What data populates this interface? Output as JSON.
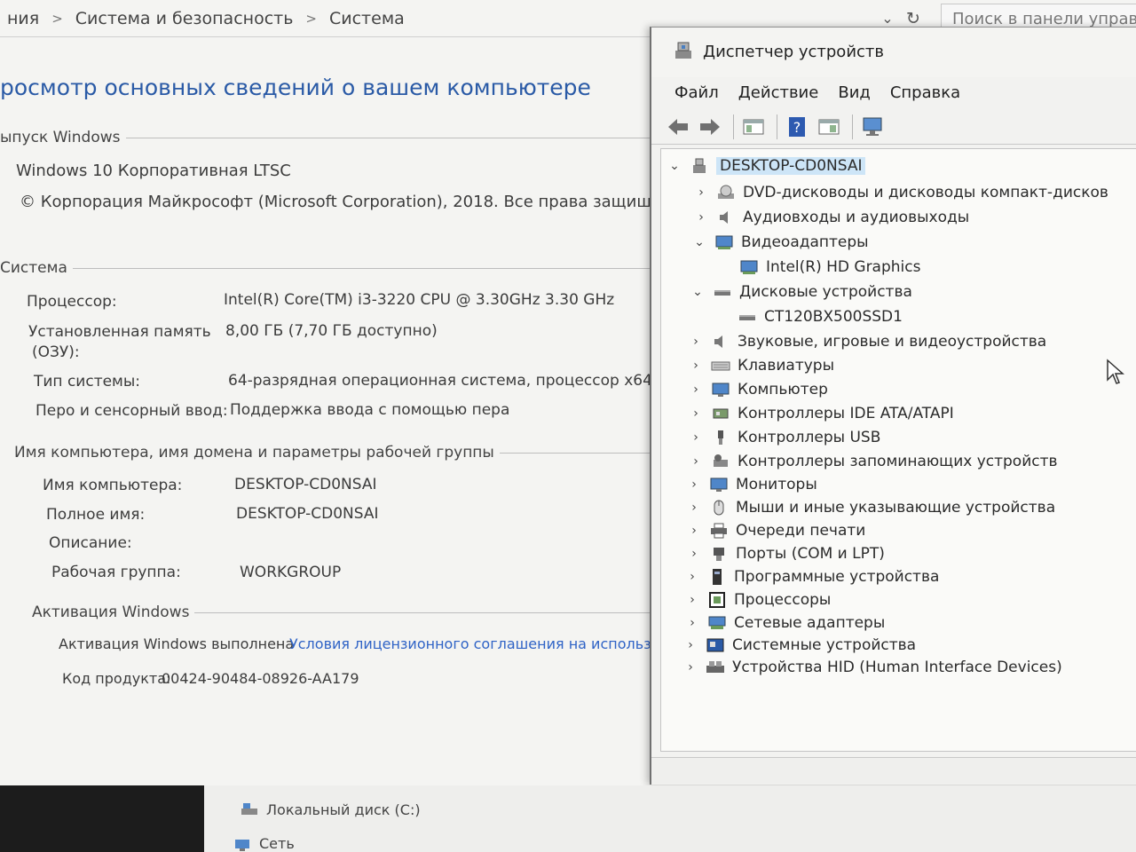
{
  "address_bar": {
    "crumbs": [
      "ния",
      "Система и безопасность",
      "Система"
    ],
    "search_placeholder": "Поиск в панели управл"
  },
  "system": {
    "title": "росмотр основных сведений о вашем компьютере",
    "windows_edition_header": "ыпуск Windows",
    "edition": "Windows 10 Корпоративная LTSC",
    "copyright": "© Корпорация Майкрософт (Microsoft Corporation), 2018. Все права защищены.",
    "system_header": "Система",
    "processor_label": "Процессор:",
    "processor_value": "Intel(R) Core(TM) i3-3220 CPU @ 3.30GHz   3.30 GHz",
    "memory_label_1": "Установленная память",
    "memory_label_2": "(ОЗУ):",
    "memory_value": "8,00 ГБ (7,70 ГБ доступно)",
    "systype_label": "Тип системы:",
    "systype_value": "64-разрядная операционная система, процессор x64",
    "pen_label": "Перо и сенсорный ввод:",
    "pen_value": "Поддержка ввода с помощью пера",
    "computer_header": "Имя компьютера, имя домена и параметры рабочей группы",
    "computer_name_label": "Имя компьютера:",
    "computer_name_value": "DESKTOP-CD0NSAI",
    "full_name_label": "Полное имя:",
    "full_name_value": "DESKTOP-CD0NSAI",
    "description_label": "Описание:",
    "workgroup_label": "Рабочая группа:",
    "workgroup_value": "WORKGROUP",
    "activation_header": "Активация Windows",
    "activation_status": "Активация Windows выполнена",
    "activation_link": "Условия лицензионного соглашения на использов",
    "product_key_label": "Код продукта:",
    "product_key_value": "00424-90484-08926-AA179"
  },
  "device_manager": {
    "title": "Диспетчер устройств",
    "menu": [
      "Файл",
      "Действие",
      "Вид",
      "Справка"
    ],
    "root": "DESKTOP-CD0NSAI",
    "items": [
      "DVD-дисководы и дисководы компакт-дисков",
      "Аудиовходы и аудиовыходы",
      "Видеоадаптеры",
      "Intel(R) HD Graphics",
      "Дисковые устройства",
      "CT120BX500SSD1",
      "Звуковые, игровые и видеоустройства",
      "Клавиатуры",
      "Компьютер",
      "Контроллеры IDE ATA/ATAPI",
      "Контроллеры USB",
      "Контроллеры запоминающих устройств",
      "Мониторы",
      "Мыши и иные указывающие устройства",
      "Очереди печати",
      "Порты (COM и LPT)",
      "Программные устройства",
      "Процессоры",
      "Сетевые адаптеры",
      "Системные устройства",
      "Устройства HID (Human Interface Devices)"
    ]
  },
  "explorer_nav": {
    "local_disk": "Локальный диск (C:)",
    "network": "Сеть"
  },
  "colors": {
    "title_blue": "#2a5aa6",
    "link_blue": "#2f63c6",
    "selection": "#cde5f7"
  }
}
